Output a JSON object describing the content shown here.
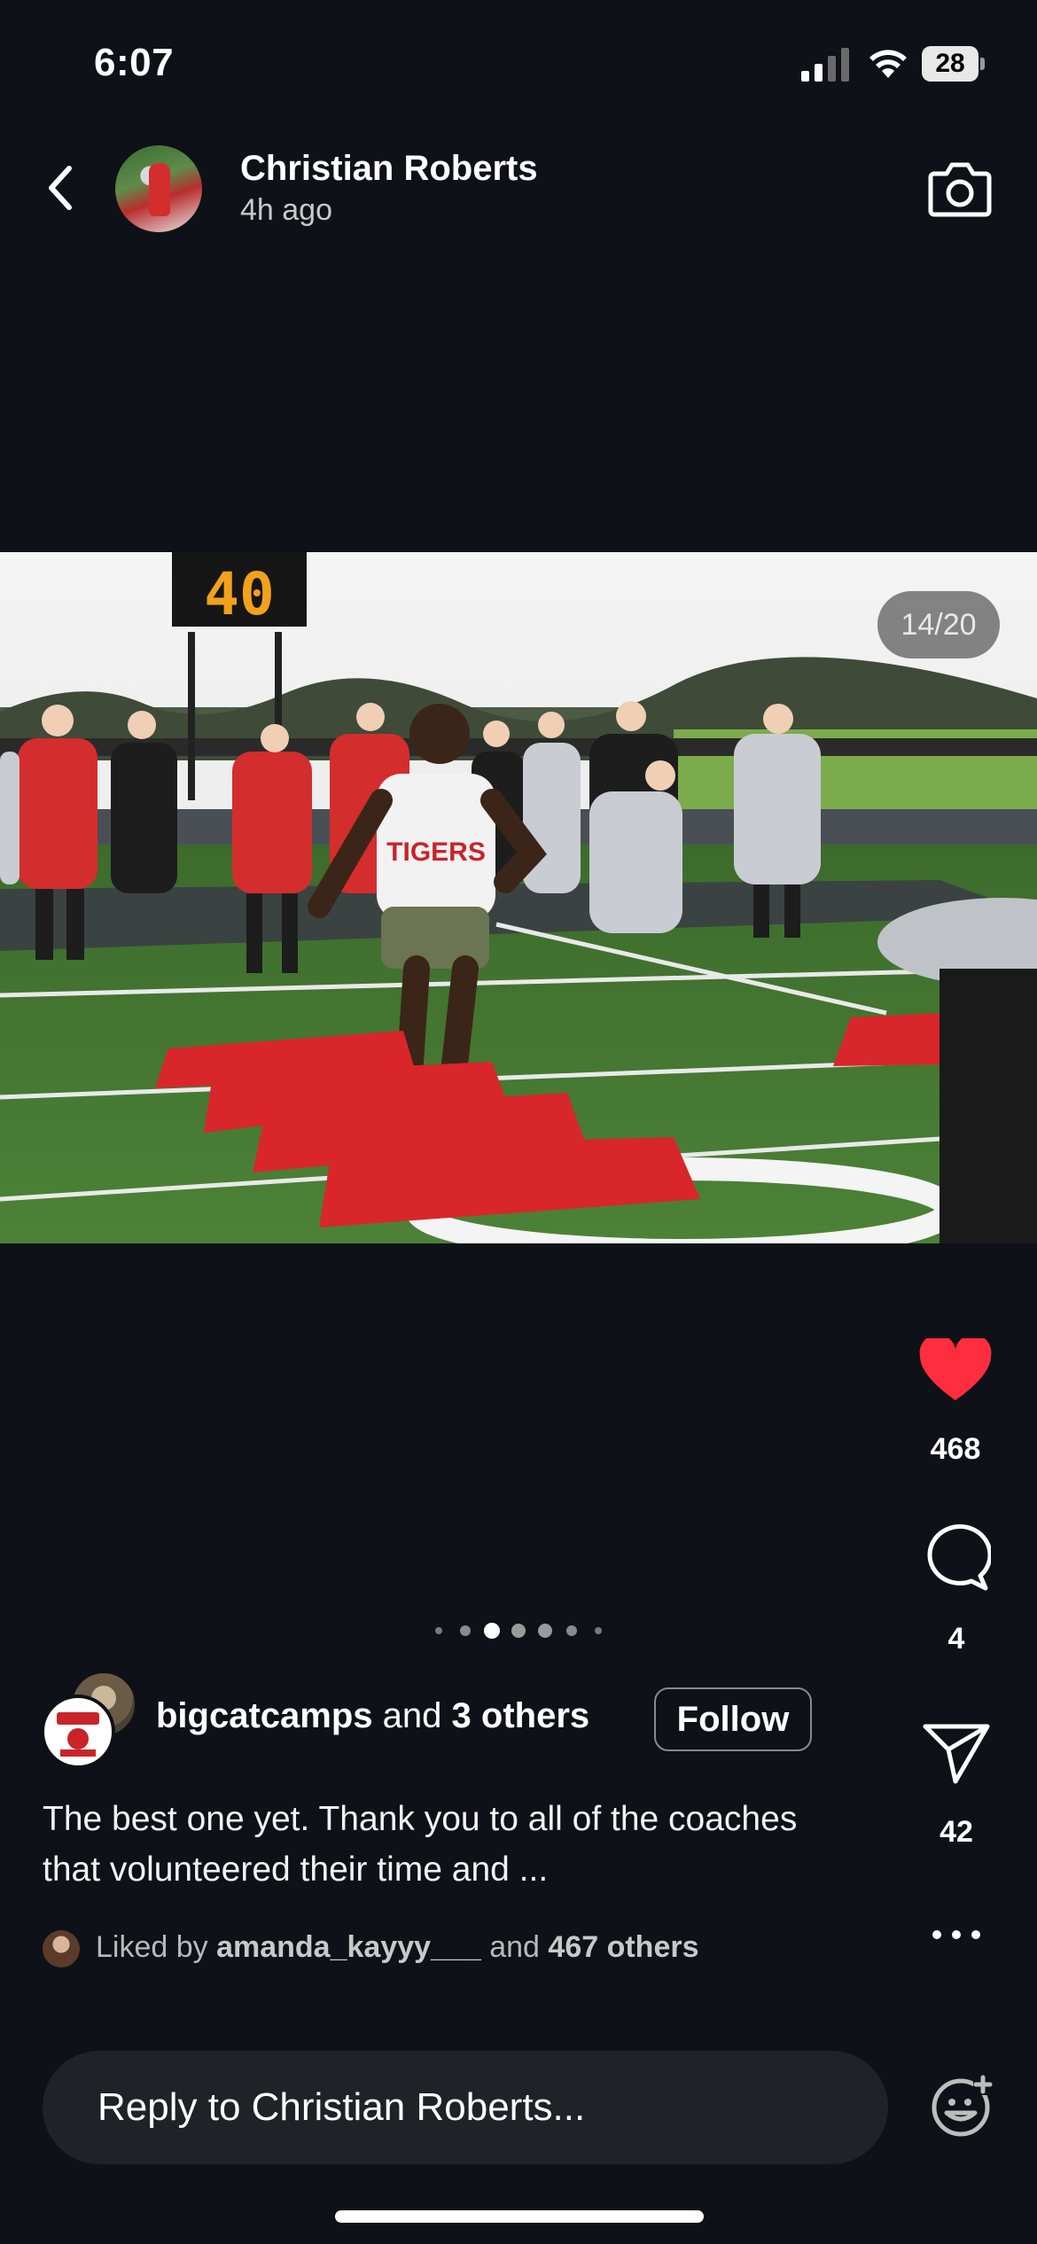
{
  "status_bar": {
    "time": "6:07",
    "battery_level": "28",
    "icons": [
      "signal-icon",
      "wifi-icon",
      "battery-icon"
    ]
  },
  "header": {
    "user_name": "Christian Roberts",
    "post_time": "4h ago",
    "icons": [
      "back-chevron-icon",
      "camera-icon"
    ]
  },
  "photo": {
    "counter": "14/20",
    "scoreboard_text": "40",
    "shirt_text": "TIGERS"
  },
  "actions": {
    "like_count": "468",
    "comment_count": "4",
    "share_count": "42",
    "liked": true,
    "colors": {
      "like": "#ff2d3d"
    },
    "icons": [
      "heart-icon",
      "comment-bubble-icon",
      "send-icon",
      "more-dots-icon"
    ]
  },
  "pagination": {
    "dot_count": 7,
    "active_index": 2
  },
  "author": {
    "username": "bigcatcamps",
    "and_text": "and",
    "others_text": "3 others",
    "follow_label": "Follow"
  },
  "caption": "The best one yet. Thank you to all of the coaches that volunteered their time and ...",
  "liked_by": {
    "prefix": "Liked by",
    "user": "amanda_kayyy___",
    "and_text": "and",
    "others": "467 others"
  },
  "reply": {
    "placeholder": "Reply to Christian Roberts...",
    "icons": [
      "sticker-icon"
    ]
  }
}
